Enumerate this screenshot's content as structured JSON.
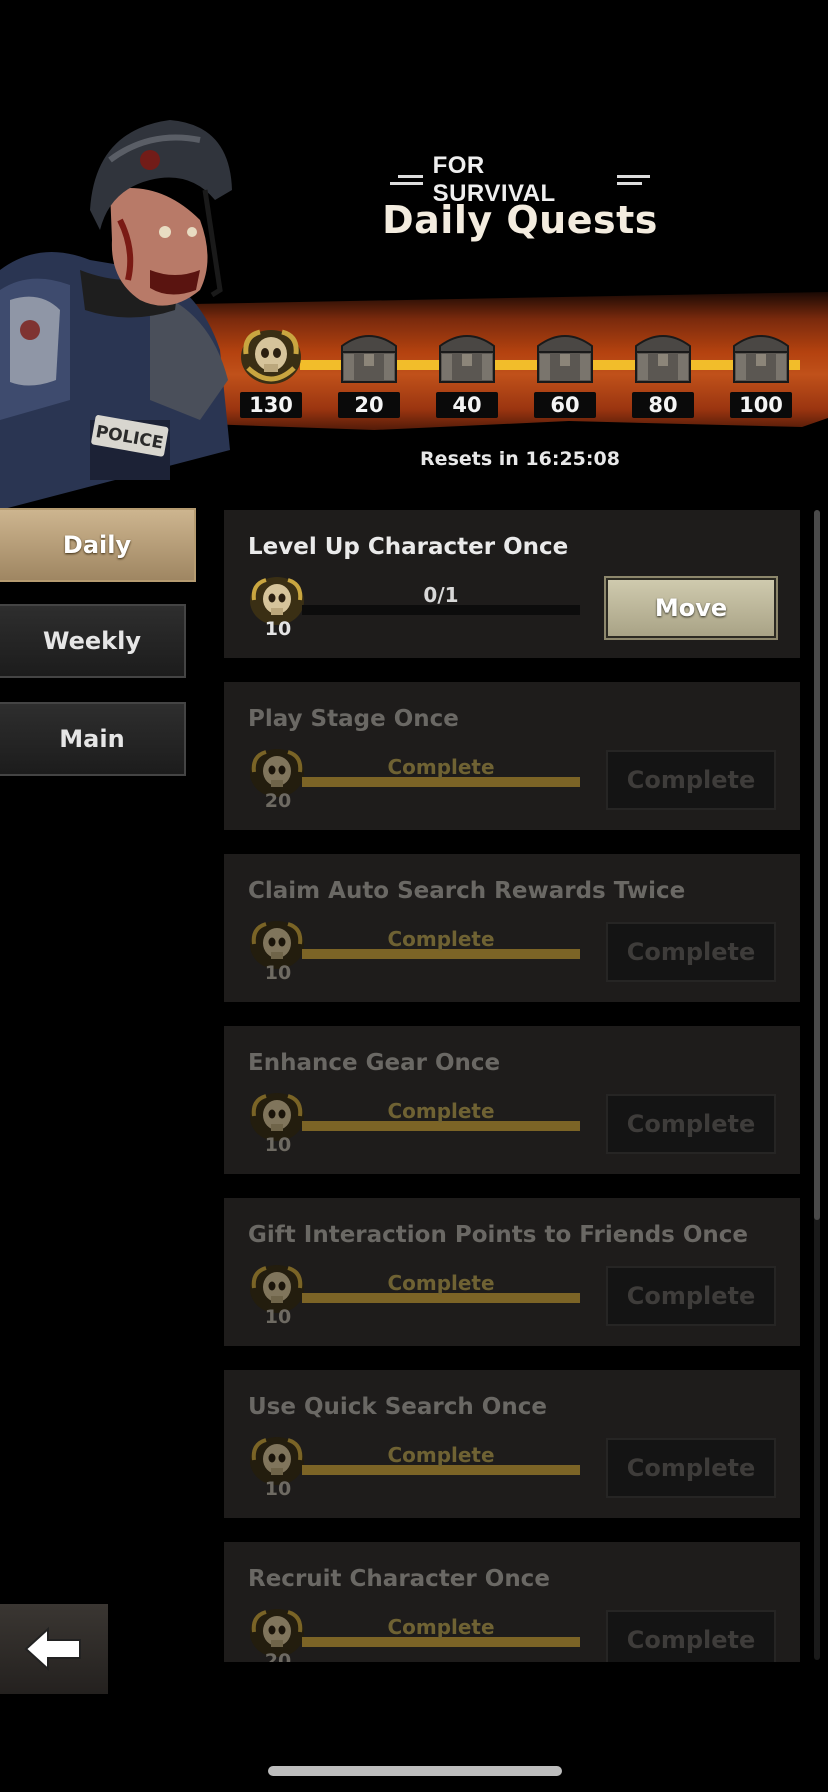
{
  "header": {
    "subtitle": "FOR SURVIVAL",
    "title": "Daily Quests"
  },
  "rewards": {
    "milestones": [
      "130",
      "20",
      "40",
      "60",
      "80",
      "100"
    ],
    "track_color": "#f2bd2a"
  },
  "resets_text": "Resets in 16:25:08",
  "tabs": [
    {
      "label": "Daily",
      "active": true
    },
    {
      "label": "Weekly",
      "active": false
    },
    {
      "label": "Main",
      "active": false
    }
  ],
  "quests": [
    {
      "name": "Level Up Character Once",
      "points": "10",
      "progress": "0/1",
      "button": "Move",
      "state": "active"
    },
    {
      "name": "Play Stage Once",
      "points": "20",
      "progress": "Complete",
      "button": "Complete",
      "state": "done"
    },
    {
      "name": "Claim Auto Search Rewards Twice",
      "points": "10",
      "progress": "Complete",
      "button": "Complete",
      "state": "done"
    },
    {
      "name": "Enhance Gear Once",
      "points": "10",
      "progress": "Complete",
      "button": "Complete",
      "state": "done"
    },
    {
      "name": "Gift Interaction Points to Friends Once",
      "points": "10",
      "progress": "Complete",
      "button": "Complete",
      "state": "done"
    },
    {
      "name": "Use Quick Search Once",
      "points": "10",
      "progress": "Complete",
      "button": "Complete",
      "state": "done"
    },
    {
      "name": "Recruit Character Once",
      "points": "20",
      "progress": "Complete",
      "button": "Complete",
      "state": "done"
    }
  ],
  "character_badge": "POLICE",
  "back_icon": "arrow-left-icon",
  "colors": {
    "accent": "#f2bd2a",
    "banner": "#b4420f",
    "move_button": "#cfcaae",
    "active_tab": "#cdb58f"
  }
}
